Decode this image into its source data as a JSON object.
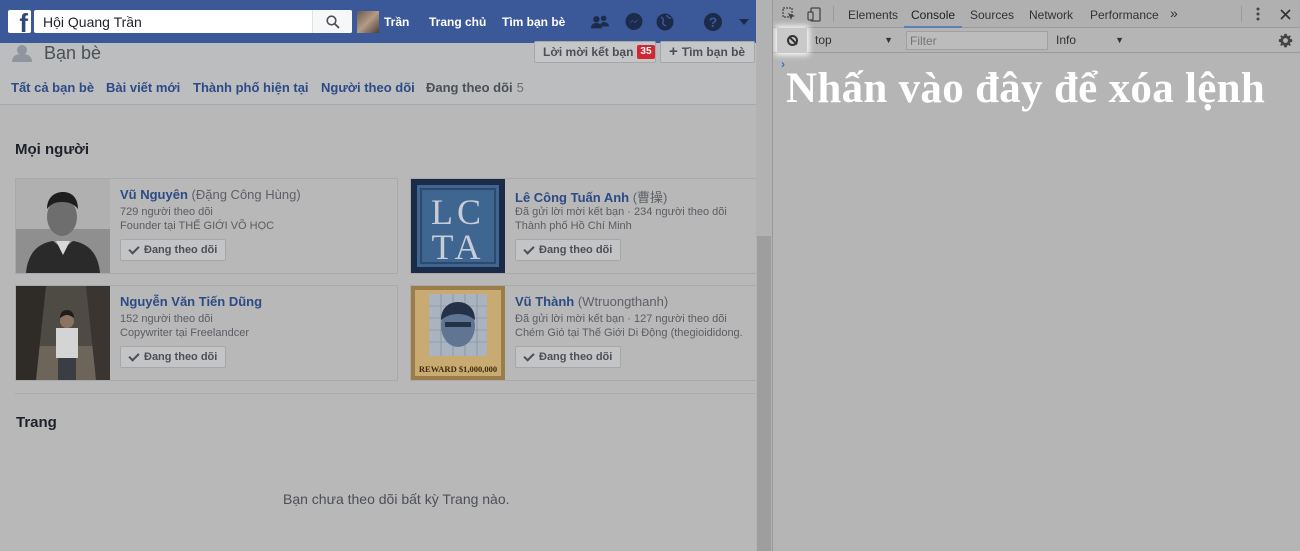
{
  "facebook": {
    "search": {
      "value": "Hội Quang Trần"
    },
    "nav": {
      "user": "Trần",
      "home": "Trang chủ",
      "find_friends": "Tìm bạn bè"
    },
    "page_title": "Bạn bè",
    "buttons": {
      "friend_requests": "Lời mời kết bạn",
      "friend_requests_count": "35",
      "find_friends": "Tìm bạn bè"
    },
    "tabs": [
      {
        "label": "Tất cả bạn bè"
      },
      {
        "label": "Bài viết mới"
      },
      {
        "label": "Thành phố hiện tại"
      },
      {
        "label": "Người theo dõi"
      },
      {
        "label": "Đang theo dõi",
        "count": "5"
      }
    ],
    "people_title": "Mọi người",
    "people": [
      {
        "name": "Vũ Nguyên",
        "alt_name": "(Đặng Công Hùng)",
        "line1": "729 người theo dõi",
        "line2": "Founder tại THẾ GIỚI VÕ HỌC",
        "button": "Đang theo dõi"
      },
      {
        "name": "Lê Công Tuấn Anh",
        "alt_name": "(曹操)",
        "line1": "Đã gửi lời mời kết bạn · 234 người theo dõi",
        "line2": "Thành phố Hồ Chí Minh",
        "button": "Đang theo dõi",
        "photo_text_top": "LC",
        "photo_text_bottom": "TA"
      },
      {
        "name": "Nguyễn Văn Tiến Dũng",
        "alt_name": "",
        "line1": "152 người theo dõi",
        "line2": "Copywriter tại Freelandcer",
        "button": "Đang theo dõi"
      },
      {
        "name": "Vũ Thành",
        "alt_name": "(Wtruongthanh)",
        "line1": "Đã gửi lời mời kết bạn · 127 người theo dõi",
        "line2": "Chém Gió tại Thế Giới Di Động (thegioididong.",
        "button": "Đang theo dõi",
        "photo_text": "REWARD $1,000,000"
      }
    ],
    "pages_title": "Trang",
    "pages_empty": "Bạn chưa theo dõi bất kỳ Trang nào."
  },
  "devtools": {
    "tabs": [
      "Elements",
      "Console",
      "Sources",
      "Network",
      "Performance"
    ],
    "active_tab": "Console",
    "more": "»",
    "context": "top",
    "filter_placeholder": "Filter",
    "level": "Info",
    "prompt": "›",
    "annotation": "Nhấn vào đây để xóa lệnh"
  },
  "colors": {
    "facebook_blue": "#3b5998",
    "link": "#2c4a86",
    "badge": "#d02735",
    "annotation": "#ffffff"
  }
}
